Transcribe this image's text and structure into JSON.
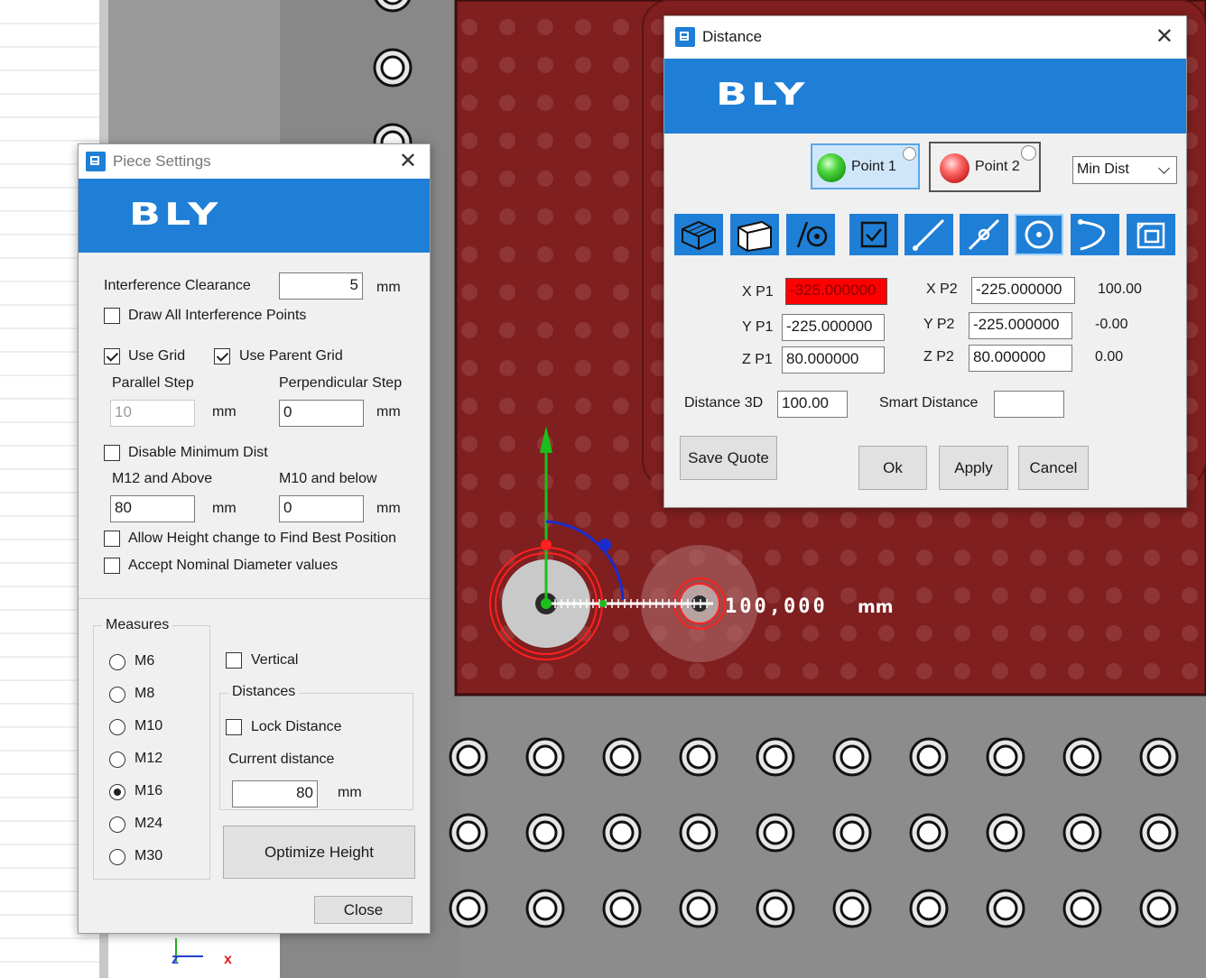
{
  "viewport": {
    "measure_label": "100,000",
    "measure_unit": "mm",
    "axis_z": "z",
    "axis_x": "x"
  },
  "piece_settings": {
    "title": "Piece Settings",
    "logo": "BLY",
    "interference_clearance_label": "Interference Clearance",
    "interference_clearance_value": "5",
    "unit_mm": "mm",
    "draw_all_points_label": "Draw All Interference Points",
    "draw_all_points_checked": false,
    "use_grid_label": "Use Grid",
    "use_grid_checked": true,
    "use_parent_grid_label": "Use Parent Grid",
    "use_parent_grid_checked": true,
    "parallel_step_label": "Parallel Step",
    "parallel_step_value": "10",
    "perpendicular_step_label": "Perpendicular Step",
    "perpendicular_step_value": "0",
    "disable_min_dist_label": "Disable Minimum Dist",
    "disable_min_dist_checked": false,
    "m12_above_label": "M12 and Above",
    "m12_above_value": "80",
    "m10_below_label": "M10 and below",
    "m10_below_value": "0",
    "allow_height_label": "Allow Height change to Find Best Position",
    "accept_nominal_label": "Accept Nominal Diameter values",
    "measures_label": "Measures",
    "measures": [
      {
        "label": "M6",
        "checked": false
      },
      {
        "label": "M8",
        "checked": false
      },
      {
        "label": "M10",
        "checked": false
      },
      {
        "label": "M12",
        "checked": false
      },
      {
        "label": "M16",
        "checked": true
      },
      {
        "label": "M24",
        "checked": false
      },
      {
        "label": "M30",
        "checked": false
      }
    ],
    "vertical_label": "Vertical",
    "distances_label": "Distances",
    "lock_distance_label": "Lock Distance",
    "current_distance_label": "Current distance",
    "current_distance_value": "80",
    "optimize_height_label": "Optimize Height",
    "close_label": "Close"
  },
  "distance_dialog": {
    "title": "Distance",
    "logo": "BLY",
    "point1_label": "Point 1",
    "point2_label": "Point 2",
    "mode_value": "Min Dist",
    "tools": [
      "box-wire-icon",
      "box-solid-icon",
      "line-circle-icon",
      "checkbox-icon",
      "line-icon",
      "line-point-icon",
      "circle-center-icon",
      "arc-icon",
      "face-icon"
    ],
    "xp1_label": "X P1",
    "xp1_value": "-325.000000",
    "yp1_label": "Y P1",
    "yp1_value": "-225.000000",
    "zp1_label": "Z P1",
    "zp1_value": "80.000000",
    "xp2_label": "X P2",
    "xp2_value": "-225.000000",
    "yp2_label": "Y P2",
    "yp2_value": "-225.000000",
    "zp2_label": "Z P2",
    "zp2_value": "80.000000",
    "dx": "100.00",
    "dy": "-0.00",
    "dz": "0.00",
    "distance3d_label": "Distance 3D",
    "distance3d_value": "100.00",
    "smart_distance_label": "Smart Distance",
    "smart_distance_value": "",
    "save_quote_label": "Save Quote",
    "ok_label": "Ok",
    "apply_label": "Apply",
    "cancel_label": "Cancel",
    "colors": {
      "accent": "#1f7fd6",
      "error_field": "#ff0000"
    }
  }
}
